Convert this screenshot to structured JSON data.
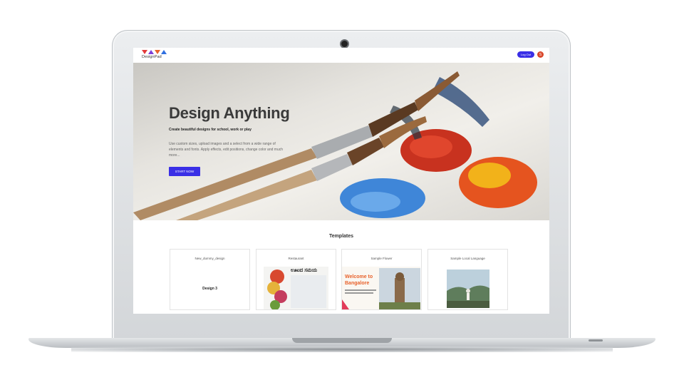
{
  "header": {
    "logo_text": "DesignPad",
    "logout_label": "Log Out",
    "avatar_initial": "S"
  },
  "hero": {
    "title": "Design Anything",
    "subtitle": "Create beautiful designs for school, work or play",
    "description": "Use custom sizes, upload images and a select from a wide range of elements and fonts. Apply effects, edit positions, change color and much more...",
    "cta": "START NOW"
  },
  "templates": {
    "title": "Templates",
    "items": [
      {
        "name": "New_dummy_design",
        "preview_text": "Design 3"
      },
      {
        "name": "Restaurant",
        "preview_text": "ಊಟದ ಸಮಯ"
      },
      {
        "name": "Sample Flower",
        "preview_text": "Welcome to Bangalore"
      },
      {
        "name": "Sample Local Language",
        "preview_text": ""
      }
    ]
  },
  "colors": {
    "primary": "#3a2fe6",
    "avatar": "#d9472b",
    "accent_orange": "#e8622c"
  }
}
